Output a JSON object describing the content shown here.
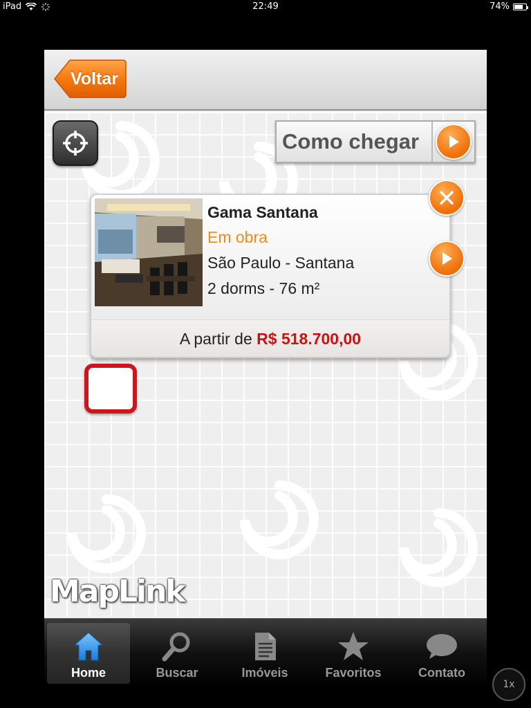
{
  "status_bar": {
    "device": "iPad",
    "time": "22:49",
    "battery": "74%",
    "battery_level": 0.74
  },
  "header": {
    "back_label": "Voltar"
  },
  "map": {
    "route_label": "Como chegar",
    "logo": "MapLink"
  },
  "popup": {
    "name": "Gama Santana",
    "status": "Em obra",
    "location": "São Paulo - Santana",
    "details": "2 dorms - 76 m²",
    "price_prefix": "A partir de ",
    "price": "R$ 518.700,00"
  },
  "tabs": [
    {
      "label": "Home",
      "icon": "home-icon",
      "active": true
    },
    {
      "label": "Buscar",
      "icon": "search-icon",
      "active": false
    },
    {
      "label": "Imóveis",
      "icon": "document-icon",
      "active": false
    },
    {
      "label": "Favoritos",
      "icon": "star-icon",
      "active": false
    },
    {
      "label": "Contato",
      "icon": "chat-bubble-icon",
      "active": false
    }
  ],
  "zoom_badge": "1x",
  "colors": {
    "accent_orange": "#f06e08",
    "price_red": "#cc1111",
    "marker_red": "#d0141c"
  }
}
